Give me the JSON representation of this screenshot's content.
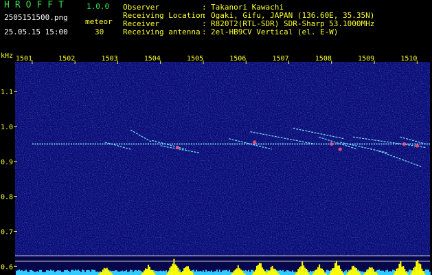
{
  "header": {
    "app_title": "HROFFT",
    "app_version": "1.0.0",
    "file_name": "2505151500.png",
    "meteor_label": "meteor",
    "datetime": "25.05.15 15:00",
    "meteor_count": "30"
  },
  "metadata": [
    {
      "key": "Observer",
      "value": "Takanori Kawachi"
    },
    {
      "key": "Receiving Location",
      "value": "Ogaki, Gifu, JAPAN (136.60E, 35.35N)"
    },
    {
      "key": "Receiver",
      "value": "R820T2(RTL-SDR) SDR-Sharp 53.1000MHz"
    },
    {
      "key": "Receiving antenna",
      "value": "2el-HB9CV Vertical (el. E-W)"
    }
  ],
  "colors": {
    "background": "#000000",
    "spectrogram_bg": "#0a0a6e",
    "label_yellow": "#ffff33",
    "title_green": "#39e04a",
    "signal_cyan": "#7fe8ff",
    "signal_red": "#ff5577",
    "level_yellow": "#ffff00",
    "level_cyan": "#33ccff"
  },
  "chart_data": {
    "type": "heatmap",
    "ylabel": "kHz",
    "x_ticks": [
      "1501",
      "1502",
      "1503",
      "1504",
      "1505",
      "1506",
      "1507",
      "1508",
      "1509",
      "1510"
    ],
    "y_ticks": [
      "1.1",
      "1.0",
      "0.9",
      "0.8",
      "0.7",
      "0.6"
    ],
    "xlim": [
      1500.6,
      1510.3
    ],
    "ylim": [
      0.575,
      1.185
    ],
    "carrier": {
      "y": 0.95,
      "x_start": 1501.0,
      "x_end": 1510.3
    },
    "meteor_echoes": [
      {
        "x": [
          1502.7,
          1503.3
        ],
        "y": [
          0.955,
          0.935
        ]
      },
      {
        "x": [
          1503.3,
          1503.8
        ],
        "y": [
          0.99,
          0.955
        ]
      },
      {
        "x": [
          1503.8,
          1504.6
        ],
        "y": [
          0.96,
          0.935
        ]
      },
      {
        "x": [
          1504.0,
          1504.9
        ],
        "y": [
          0.945,
          0.925
        ]
      },
      {
        "x": [
          1505.6,
          1506.6
        ],
        "y": [
          0.965,
          0.935
        ]
      },
      {
        "x": [
          1506.1,
          1507.6
        ],
        "y": [
          0.985,
          0.95
        ]
      },
      {
        "x": [
          1507.1,
          1508.3
        ],
        "y": [
          0.995,
          0.965
        ]
      },
      {
        "x": [
          1507.7,
          1508.6
        ],
        "y": [
          0.97,
          0.935
        ]
      },
      {
        "x": [
          1508.2,
          1509.3
        ],
        "y": [
          0.955,
          0.925
        ]
      },
      {
        "x": [
          1508.5,
          1510.2
        ],
        "y": [
          0.97,
          0.94
        ]
      },
      {
        "x": [
          1509.1,
          1510.1
        ],
        "y": [
          0.93,
          0.885
        ]
      },
      {
        "x": [
          1509.6,
          1510.2
        ],
        "y": [
          0.97,
          0.95
        ]
      }
    ],
    "bright_spots": [
      {
        "x": 1504.4,
        "y": 0.94
      },
      {
        "x": 1506.2,
        "y": 0.955
      },
      {
        "x": 1508.0,
        "y": 0.95
      },
      {
        "x": 1508.2,
        "y": 0.935
      },
      {
        "x": 1509.7,
        "y": 0.95
      },
      {
        "x": 1510.0,
        "y": 0.945
      }
    ],
    "level_bursts": [
      {
        "x": 1502.7,
        "level": 0.5
      },
      {
        "x": 1503.7,
        "level": 0.6
      },
      {
        "x": 1504.3,
        "level": 0.9
      },
      {
        "x": 1504.6,
        "level": 0.6
      },
      {
        "x": 1505.8,
        "level": 0.55
      },
      {
        "x": 1506.3,
        "level": 0.8
      },
      {
        "x": 1506.6,
        "level": 0.55
      },
      {
        "x": 1507.3,
        "level": 0.75
      },
      {
        "x": 1507.7,
        "level": 0.6
      },
      {
        "x": 1508.1,
        "level": 0.85
      },
      {
        "x": 1508.5,
        "level": 0.6
      },
      {
        "x": 1508.9,
        "level": 0.55
      },
      {
        "x": 1509.6,
        "level": 0.8
      },
      {
        "x": 1510.0,
        "level": 0.95
      }
    ],
    "grid": false
  }
}
